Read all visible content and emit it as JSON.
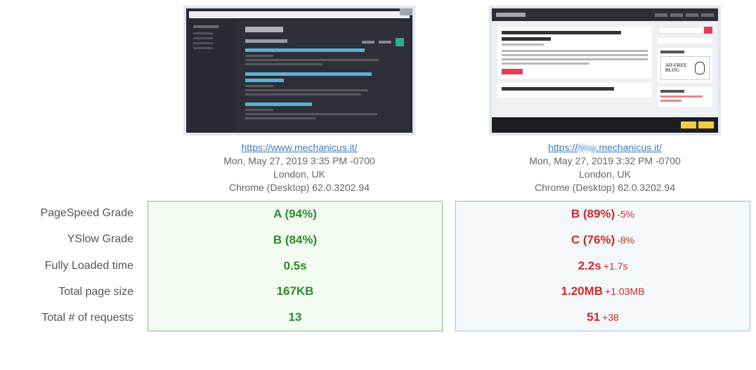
{
  "compare": {
    "left": {
      "url": "https://www.mechanicus.it/",
      "timestamp": "Mon, May 27, 2019 3:35 PM -0700",
      "location": "London, UK",
      "browser": "Chrome (Desktop) 62.0.3202.94"
    },
    "right": {
      "url_prefix": "https://",
      "url_blur": "blog",
      "url_suffix": ".mechanicus.it/",
      "timestamp": "Mon, May 27, 2019 3:32 PM -0700",
      "location": "London, UK",
      "browser": "Chrome (Desktop) 62.0.3202.94"
    }
  },
  "labels": {
    "pagespeed": "PageSpeed Grade",
    "yslow": "YSlow Grade",
    "loaded": "Fully Loaded time",
    "pagesize": "Total page size",
    "requests": "Total # of requests"
  },
  "results": {
    "left": {
      "pagespeed": "A (94%)",
      "yslow": "B (84%)",
      "loaded": "0.5s",
      "pagesize": "167KB",
      "requests": "13"
    },
    "right": {
      "pagespeed": "B (89%)",
      "pagespeed_delta": "-5%",
      "yslow": "C (76%)",
      "yslow_delta": "-8%",
      "loaded": "2.2s",
      "loaded_delta": "+1.7s",
      "pagesize": "1.20MB",
      "pagesize_delta": "+1.03MB",
      "requests": "51",
      "requests_delta": "+38"
    }
  },
  "thumb_dark": {
    "ad_text": "AD-FREE\nBLOG"
  }
}
